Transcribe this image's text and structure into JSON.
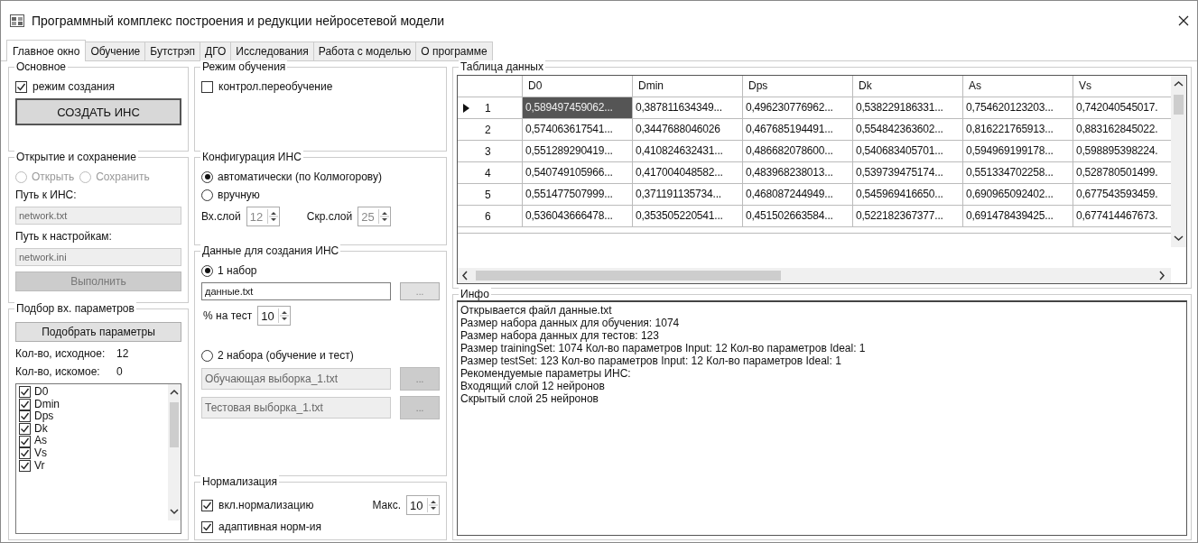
{
  "window": {
    "title": "Программный комплекс построения и редукции нейросетевой модели"
  },
  "tabs": [
    {
      "label": "Главное окно",
      "selected": true
    },
    {
      "label": "Обучение",
      "selected": false
    },
    {
      "label": "Бутстрэп",
      "selected": false
    },
    {
      "label": "ДГО",
      "selected": false
    },
    {
      "label": "Исследования",
      "selected": false
    },
    {
      "label": "Работа с моделью",
      "selected": false
    },
    {
      "label": "О программе",
      "selected": false
    }
  ],
  "basic": {
    "title": "Основное",
    "creation_mode": {
      "label": "режим создания",
      "checked": true
    },
    "create_button": {
      "label": "СОЗДАТЬ ИНС",
      "disabled": false
    }
  },
  "open_save": {
    "title": "Открытие и сохранение",
    "modes": [
      {
        "label": "Открыть",
        "selected": false,
        "disabled": true
      },
      {
        "label": "Сохранить",
        "selected": false,
        "disabled": true
      }
    ],
    "network_path": {
      "label": "Путь к ИНС:",
      "value": "network.txt",
      "disabled": true
    },
    "settings_path": {
      "label": "Путь к настройкам:",
      "value": "network.ini",
      "disabled": true
    },
    "run_button": {
      "label": "Выполнить",
      "disabled": true
    }
  },
  "params": {
    "title": "Подбор вх. параметров",
    "pick_button": {
      "label": "Подобрать параметры"
    },
    "source_count": {
      "label": "Кол-во, исходное:",
      "value": "12"
    },
    "target_count": {
      "label": "Кол-во, искомое:",
      "value": "0"
    },
    "items": [
      {
        "label": "D0",
        "checked": true
      },
      {
        "label": "Dmin",
        "checked": true
      },
      {
        "label": "Dps",
        "checked": true
      },
      {
        "label": "Dk",
        "checked": true
      },
      {
        "label": "As",
        "checked": true
      },
      {
        "label": "Vs",
        "checked": true
      },
      {
        "label": "Vr",
        "checked": true
      }
    ]
  },
  "training_mode": {
    "title": "Режим обучения",
    "overfit_control": {
      "label": "контрол.переобучение",
      "checked": false
    }
  },
  "config": {
    "title": "Конфигурация ИНС",
    "options": [
      {
        "label": "автоматически (по Колмогорову)",
        "selected": true
      },
      {
        "label": "вручную",
        "selected": false
      }
    ],
    "input_layer": {
      "label": "Вх.слой",
      "value": "12",
      "disabled": true
    },
    "hidden_layer": {
      "label": "Скр.слой",
      "value": "25",
      "disabled": true
    }
  },
  "data": {
    "title": "Данные для создания ИНС",
    "one_set": {
      "label": "1 набор",
      "selected": true
    },
    "file": {
      "value": "данные.txt",
      "disabled": false
    },
    "browse": {
      "label": "...",
      "disabled": false
    },
    "test_percent": {
      "label": "% на тест",
      "value": "10"
    },
    "two_sets": {
      "label": "2 набора (обучение и тест)",
      "selected": false
    },
    "train_file": {
      "value": "Обучающая выборка_1.txt",
      "disabled": true
    },
    "train_browse": {
      "label": "...",
      "disabled": true
    },
    "test_file": {
      "value": "Тестовая выборка_1.txt",
      "disabled": true
    },
    "test_browse": {
      "label": "...",
      "disabled": true
    }
  },
  "normalization": {
    "title": "Нормализация",
    "enable": {
      "label": "вкл.нормализацию",
      "checked": true
    },
    "max": {
      "label": "Макс.",
      "value": "10"
    },
    "adaptive": {
      "label": "адаптивная норм-ия",
      "checked": true
    }
  },
  "table": {
    "title": "Таблица данных",
    "columns": [
      "D0",
      "Dmin",
      "Dps",
      "Dk",
      "As",
      "Vs"
    ],
    "rows": [
      {
        "index": "1",
        "current": true,
        "cells": [
          "0,589497459062...",
          "0,387811634349...",
          "0,496230776962...",
          "0,538229186331...",
          "0,754620123203...",
          "0,742040545017."
        ]
      },
      {
        "index": "2",
        "current": false,
        "cells": [
          "0,574063617541...",
          "0,3447688046026",
          "0,467685194491...",
          "0,554842363602...",
          "0,816221765913...",
          "0,883162845022."
        ]
      },
      {
        "index": "3",
        "current": false,
        "cells": [
          "0,551289290419...",
          "0,410824632431...",
          "0,486682078600...",
          "0,540683405701...",
          "0,594969199178...",
          "0,598895398224."
        ]
      },
      {
        "index": "4",
        "current": false,
        "cells": [
          "0,540749105966...",
          "0,417004048582...",
          "0,483968238013...",
          "0,539739475174...",
          "0,551334702258...",
          "0,528780501499."
        ]
      },
      {
        "index": "5",
        "current": false,
        "cells": [
          "0,551477507999...",
          "0,371191135734...",
          "0,468087244949...",
          "0,545969416650...",
          "0,690965092402...",
          "0,677543593459."
        ]
      },
      {
        "index": "6",
        "current": false,
        "cells": [
          "0,536043666478...",
          "0,353505220541...",
          "0,451502663584...",
          "0,522182367377...",
          "0,691478439425...",
          "0,677414467673."
        ]
      }
    ]
  },
  "info": {
    "title": "Инфо",
    "lines": [
      "Открывается файл данные.txt",
      "Размер набора данных для обучения: 1074",
      "Размер набора данных для тестов: 123",
      "Размер trainingSet: 1074 Кол-во параметров Input: 12 Кол-во параметров Ideal: 1",
      "Размер testSet: 123 Кол-во параметров Input: 12 Кол-во параметров Ideal: 1",
      "Рекомендуемые параметры ИНС:",
      "Входящий слой 12 нейронов",
      "Скрытый слой 25 нейронов"
    ]
  }
}
